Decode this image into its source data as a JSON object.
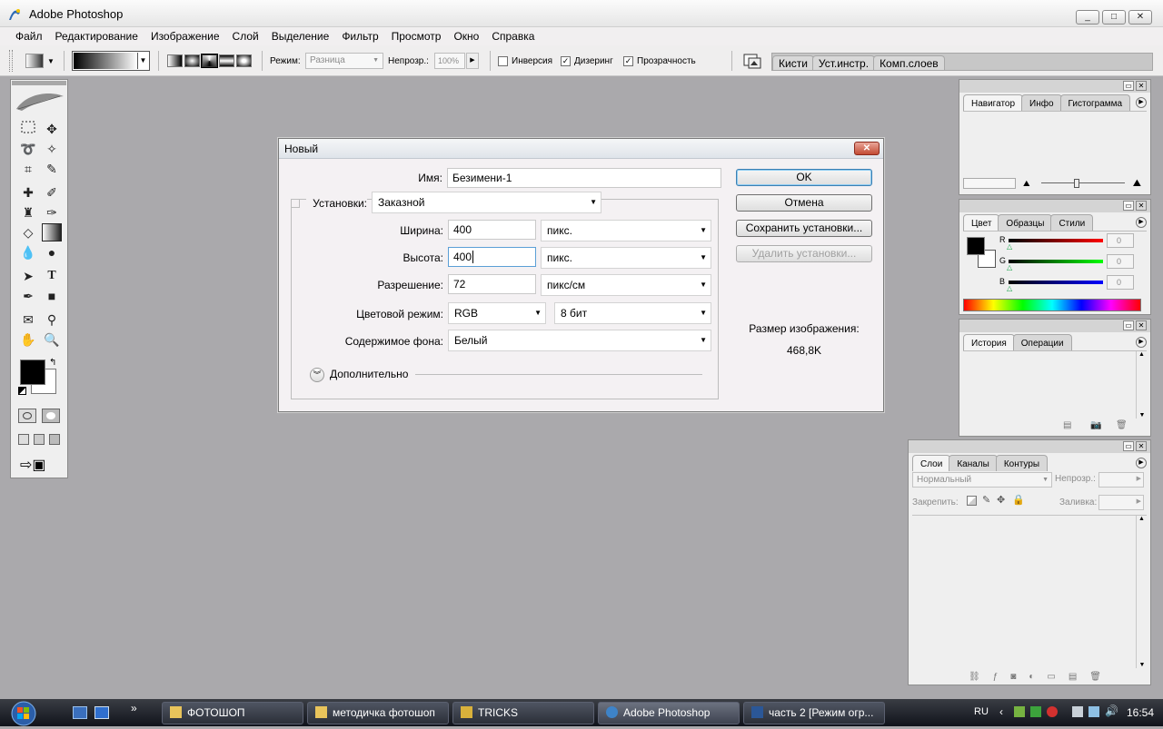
{
  "window": {
    "title": "Adobe Photoshop",
    "buttons": [
      "_",
      "□",
      "✕"
    ]
  },
  "menu": [
    "Файл",
    "Редактирование",
    "Изображение",
    "Слой",
    "Выделение",
    "Фильтр",
    "Просмотр",
    "Окно",
    "Справка"
  ],
  "options": {
    "mode_label": "Режим:",
    "mode_value": "Разница",
    "opacity_label": "Непрозр.:",
    "opacity_value": "100%",
    "inverse": "Инверсия",
    "dither": "Дизеринг",
    "transparency": "Прозрачность",
    "well_tabs": [
      "Кисти",
      "Уст.инстр.",
      "Комп.слоев"
    ]
  },
  "dialog": {
    "title": "Новый",
    "name_label": "Имя:",
    "name_value": "Безимени-1",
    "preset_label": "Установки:",
    "preset_value": "Заказной",
    "width_label": "Ширина:",
    "width_value": "400",
    "width_unit": "пикс.",
    "height_label": "Высота:",
    "height_value": "400",
    "height_unit": "пикс.",
    "resolution_label": "Разрешение:",
    "resolution_value": "72",
    "resolution_unit": "пикс/см",
    "colormode_label": "Цветовой режим:",
    "colormode_value": "RGB",
    "bitdepth_value": "8 бит",
    "background_label": "Содержимое фона:",
    "background_value": "Белый",
    "advanced_label": "Дополнительно",
    "ok": "OK",
    "cancel": "Отмена",
    "save_preset": "Сохранить установки...",
    "delete_preset": "Удалить установки...",
    "size_label": "Размер изображения:",
    "size_value": "468,8K"
  },
  "panels": {
    "navigator_tabs": [
      "Навигатор",
      "Инфо",
      "Гистограмма"
    ],
    "color_tabs": [
      "Цвет",
      "Образцы",
      "Стили"
    ],
    "color_channels": [
      {
        "label": "R",
        "value": "0"
      },
      {
        "label": "G",
        "value": "0"
      },
      {
        "label": "B",
        "value": "0"
      }
    ],
    "history_tabs": [
      "История",
      "Операции"
    ],
    "layers_tabs": [
      "Слои",
      "Каналы",
      "Контуры"
    ],
    "blend_mode": "Нормальный",
    "opacity_label": "Непрозр.:",
    "lock_label": "Закрепить:",
    "fill_label": "Заливка:"
  },
  "taskbar": {
    "items": [
      "ФОТОШОП",
      "методичка фотошоп",
      "TRICKS",
      "Adobe Photoshop",
      "часть 2 [Режим огр..."
    ],
    "lang": "RU",
    "time": "16:54"
  },
  "colors": {
    "workspace": "#aaa9ac",
    "dialog_bg": "#f4f1f3",
    "accent": "#3c7fb1"
  }
}
